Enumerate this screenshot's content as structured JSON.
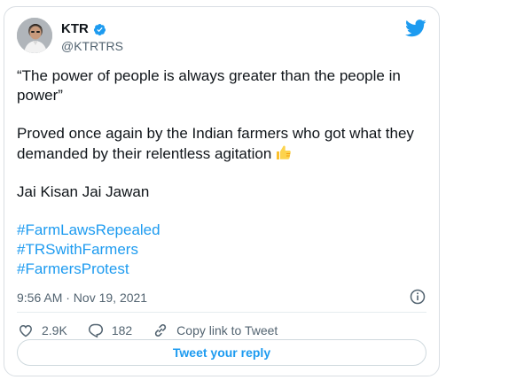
{
  "tweet": {
    "author": {
      "display_name": "KTR",
      "handle": "@KTRTRS",
      "verified": true
    },
    "text": {
      "quote_line": "“The power of people is always greater than the people in power”",
      "proof_line": "Proved once again by the Indian farmers who got what they demanded by their relentless agitation",
      "slogan_line": "Jai Kisan Jai Jawan",
      "hashtags": [
        "#FarmLawsRepealed",
        "#TRSwithFarmers",
        "#FarmersProtest"
      ]
    },
    "timestamp": "9:56 AM · Nov 19, 2021",
    "actions": {
      "likes": "2.9K",
      "replies": "182",
      "copy_link_label": "Copy link to Tweet"
    },
    "reply_button_label": "Tweet your reply"
  },
  "colors": {
    "accent": "#1d9bf0",
    "text_primary": "#0f1419",
    "text_secondary": "#536471",
    "border": "#d9dee3"
  },
  "icons": {
    "verified": "verified-badge-icon",
    "brand": "twitter-bird-icon",
    "info": "info-icon",
    "like": "heart-icon",
    "reply": "reply-bubble-icon",
    "copy_link": "link-icon",
    "emoji": "thumbs-up-emoji"
  }
}
